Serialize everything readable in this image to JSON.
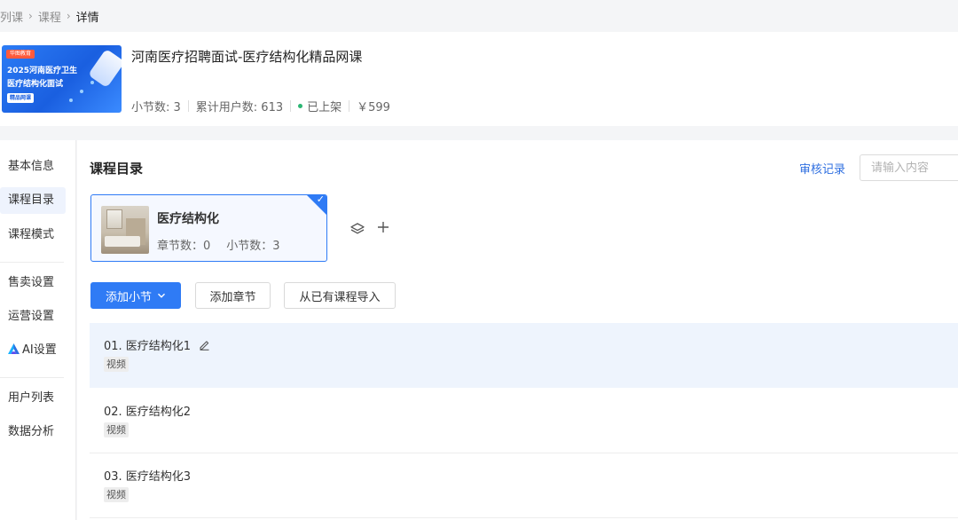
{
  "breadcrumb": {
    "items": [
      "列课",
      "课程",
      "详情"
    ]
  },
  "course": {
    "cover": {
      "tag": "华图教育",
      "line1": "2025河南医疗卫生",
      "line2": "医疗结构化面试",
      "badge": "精品网课"
    },
    "title": "河南医疗招聘面试-医疗结构化精品网课",
    "stats": {
      "lessons": "小节数: 3",
      "users": "累计用户数: 613",
      "status": "已上架",
      "price": "￥599"
    },
    "colors": {
      "status": "#2bb673",
      "accent": "#2f7bf5"
    }
  },
  "sidebar": {
    "items": [
      {
        "label": "基本信息"
      },
      {
        "label": "课程目录",
        "active": true
      },
      {
        "label": "课程模式"
      },
      {
        "label": "售卖设置"
      },
      {
        "label": "运营设置"
      },
      {
        "label": "AI设置",
        "icon": "ai-logo-icon"
      },
      {
        "label": "用户列表"
      },
      {
        "label": "数据分析"
      }
    ]
  },
  "main": {
    "title": "课程目录",
    "review_link": "审核记录",
    "search_placeholder": "请输入内容",
    "chapter": {
      "name": "医疗结构化",
      "chapter_count": "章节数：0",
      "lesson_count": "小节数：3"
    },
    "buttons": {
      "add_lesson": "添加小节",
      "add_chapter": "添加章节",
      "import": "从已有课程导入"
    },
    "lessons": [
      {
        "title": "01. 医疗结构化1",
        "tag": "视频"
      },
      {
        "title": "02. 医疗结构化2",
        "tag": "视频"
      },
      {
        "title": "03. 医疗结构化3",
        "tag": "视频"
      }
    ]
  }
}
